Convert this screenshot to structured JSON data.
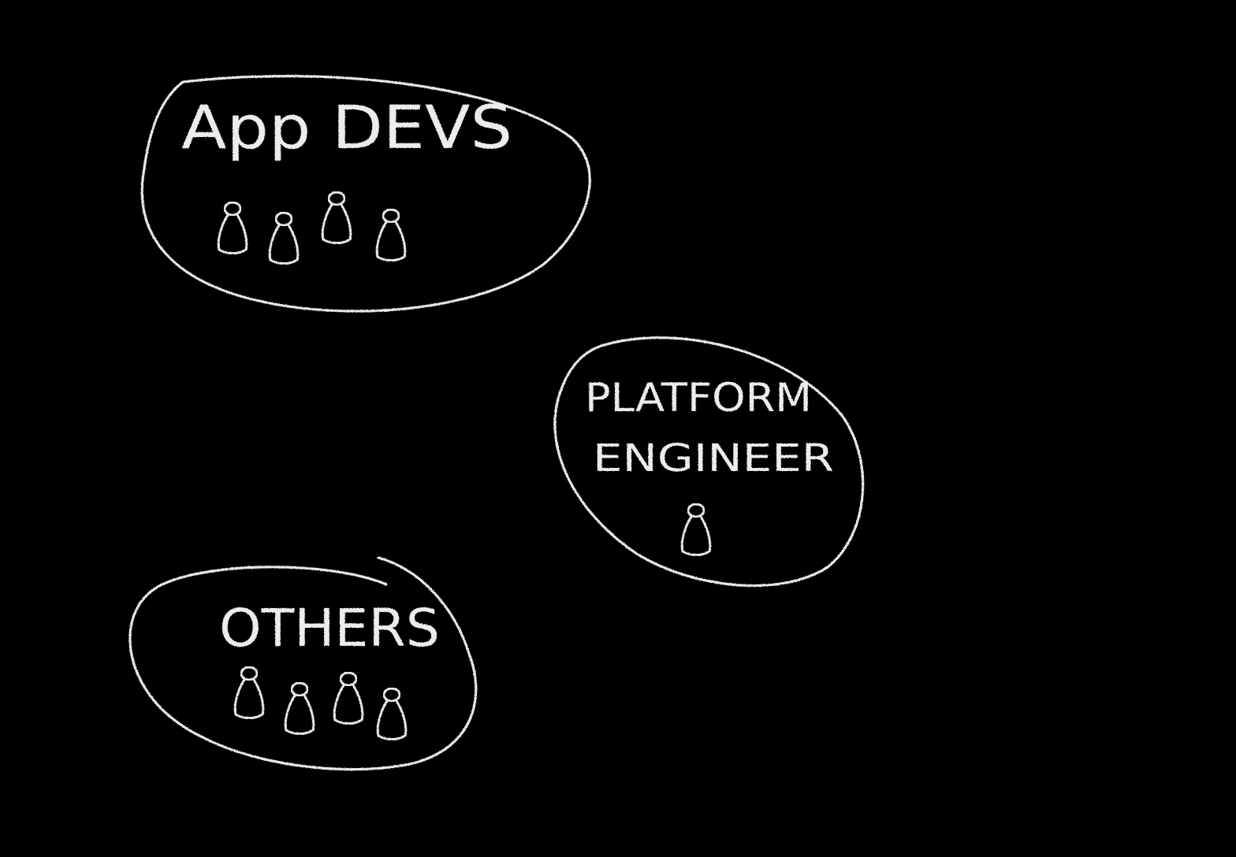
{
  "background": "#000000",
  "chalk_color": "#e9e9e9",
  "groups": [
    {
      "id": "app-devs",
      "label": "App DEVS",
      "people": 4
    },
    {
      "id": "platform-engineer",
      "label_lines": [
        "PLATFORM",
        "ENGINEER"
      ],
      "people": 1
    },
    {
      "id": "others",
      "label": "OTHERS",
      "people": 4
    }
  ]
}
